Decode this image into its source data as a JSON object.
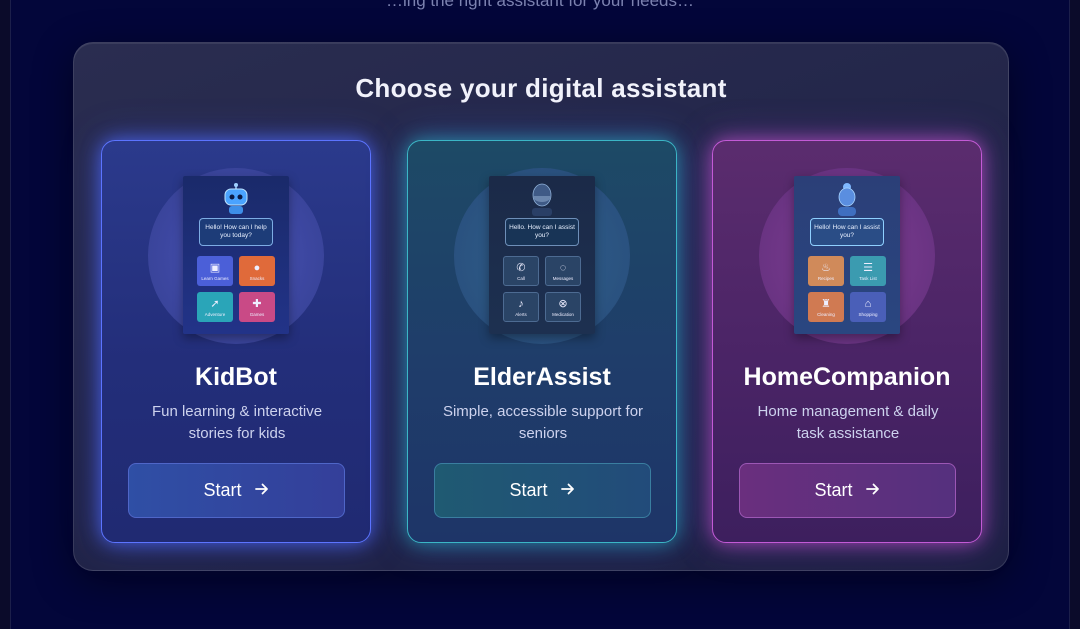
{
  "page": {
    "top_partial_text": "…ing the right assistant for your needs…"
  },
  "panel": {
    "title": "Choose your digital assistant"
  },
  "cards": [
    {
      "key": "kid",
      "title": "KidBot",
      "description": "Fun learning & interactive stories for kids",
      "button_label": "Start",
      "preview": {
        "greeting": "Hello! How can I help you today?",
        "tiles": [
          {
            "icon": "puzzle-icon",
            "label": "Learn Games",
            "color": "#4b5fd8"
          },
          {
            "icon": "cookie-icon",
            "label": "Snacks",
            "color": "#e06a3a"
          },
          {
            "icon": "rocket-icon",
            "label": "Adventure",
            "color": "#2aa5b8"
          },
          {
            "icon": "plus-icon",
            "label": "Games",
            "color": "#c94a86"
          }
        ]
      },
      "accent": "#5c74ff"
    },
    {
      "key": "elder",
      "title": "ElderAssist",
      "description": "Simple, accessible support for seniors",
      "button_label": "Start",
      "preview": {
        "greeting": "Hello. How can I assist you?",
        "tiles": [
          {
            "icon": "phone-icon",
            "label": "Call",
            "color": "#2a4466"
          },
          {
            "icon": "message-icon",
            "label": "Messages",
            "color": "#2a4466"
          },
          {
            "icon": "bell-icon",
            "label": "Alerts",
            "color": "#2a4466"
          },
          {
            "icon": "pills-icon",
            "label": "Medication",
            "color": "#2a4466"
          }
        ]
      },
      "accent": "#3bb6c6"
    },
    {
      "key": "home",
      "title": "HomeCompanion",
      "description": "Home management & daily task assistance",
      "button_label": "Start",
      "preview": {
        "greeting": "Hello! How can I assist you?",
        "tiles": [
          {
            "icon": "pot-icon",
            "label": "Recipes",
            "color": "#d08a5a"
          },
          {
            "icon": "checklist-icon",
            "label": "Task List",
            "color": "#3b9bb0"
          },
          {
            "icon": "bag-icon",
            "label": "Cleaning",
            "color": "#d07a52"
          },
          {
            "icon": "basket-icon",
            "label": "Shopping",
            "color": "#4a5fb8"
          }
        ]
      },
      "accent": "#c35ad6"
    }
  ]
}
